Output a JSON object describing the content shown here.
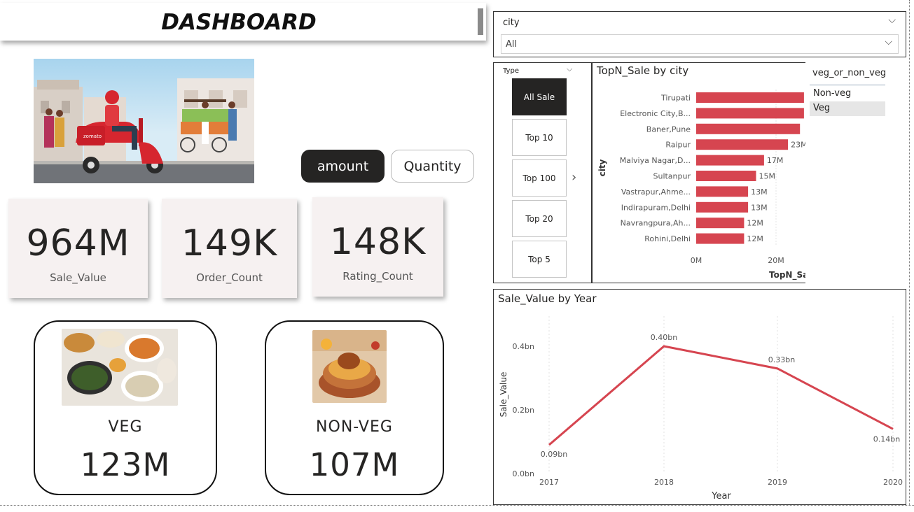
{
  "header": {
    "title": "DASHBOARD"
  },
  "toggles": {
    "amount": "amount",
    "quantity": "Quantity"
  },
  "kpis": [
    {
      "value": "964M",
      "label": "Sale_Value"
    },
    {
      "value": "149K",
      "label": "Order_Count"
    },
    {
      "value": "148K",
      "label": "Rating_Count"
    }
  ],
  "hero": {
    "brand_text": "zomato"
  },
  "veg_card": {
    "name": "VEG",
    "amount": "123M"
  },
  "nonveg_card": {
    "name": "NON-VEG",
    "amount": "107M"
  },
  "city_slicer": {
    "title": "city",
    "selected": "All"
  },
  "type_slicer": {
    "title": "Type",
    "options": [
      "All Sale",
      "Top 10",
      "Top 100",
      "Top 20",
      "Top 5"
    ],
    "selected": "All Sale"
  },
  "veg_slicer": {
    "title": "veg_or_non_veg",
    "options": [
      "Non-veg",
      "Veg"
    ],
    "selected": "Veg"
  },
  "colors": {
    "bar": "#d64550",
    "dark": "#252423"
  },
  "chart_data": [
    {
      "type": "bar",
      "orientation": "horizontal",
      "title": "TopN_Sale by city",
      "ylabel": "city",
      "xlabel": "TopN_Sa",
      "categories": [
        "Tirupati",
        "Electronic City,B...",
        "Baner,Pune",
        "Raipur",
        "Malviya Nagar,D...",
        "Sultanpur",
        "Vastrapur,Ahme...",
        "Indirapuram,Delhi",
        "Navrangpura,Ah...",
        "Rohini,Delhi"
      ],
      "values": [
        27,
        27,
        26,
        23,
        17,
        15,
        13,
        13,
        12,
        12
      ],
      "data_labels": [
        "",
        "",
        "",
        "23M",
        "17M",
        "15M",
        "13M",
        "13M",
        "12M",
        "12M"
      ],
      "x_ticks": [
        "0M",
        "20M"
      ],
      "xlim": [
        0,
        27
      ]
    },
    {
      "type": "line",
      "title": "Sale_Value by Year",
      "xlabel": "Year",
      "ylabel": "Sale_Value",
      "x": [
        "2017",
        "2018",
        "2019",
        "2020"
      ],
      "values": [
        0.09,
        0.4,
        0.33,
        0.14
      ],
      "data_labels": [
        "0.09bn",
        "0.40bn",
        "0.33bn",
        "0.14bn"
      ],
      "y_ticks": [
        "0.0bn",
        "0.2bn",
        "0.4bn"
      ],
      "ylim": [
        0,
        0.48
      ]
    }
  ]
}
